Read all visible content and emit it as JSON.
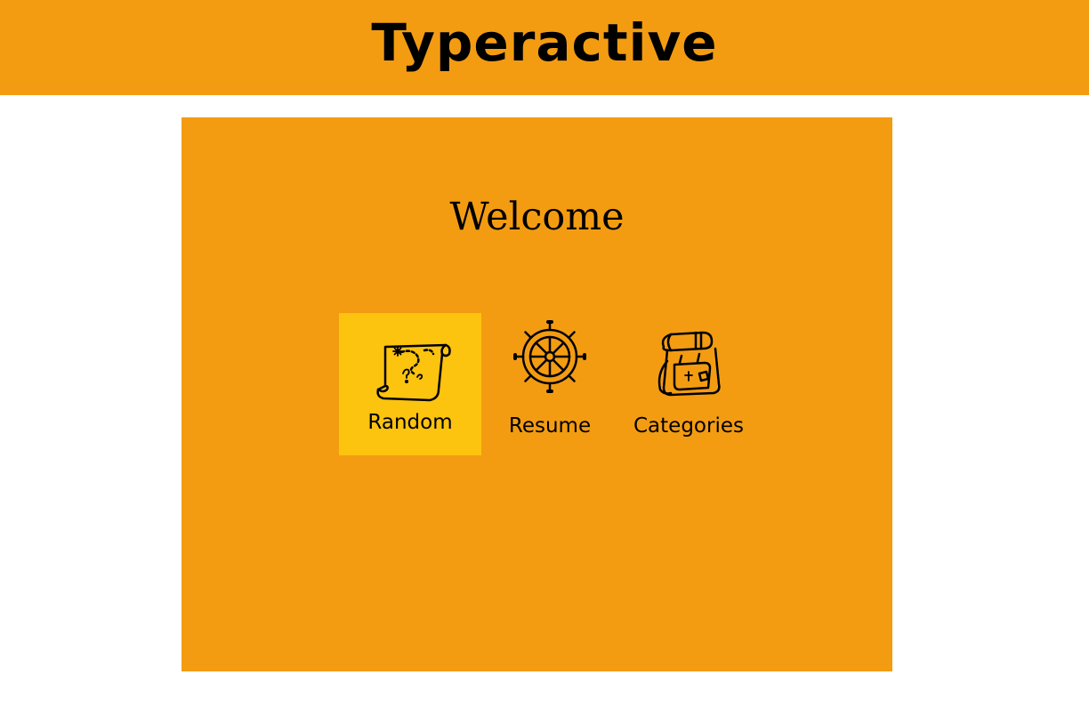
{
  "header": {
    "title": "Typeractive"
  },
  "main": {
    "welcome": "Welcome",
    "menu": [
      {
        "label": "Random",
        "icon": "treasure-map-icon",
        "selected": true
      },
      {
        "label": "Resume",
        "icon": "ship-wheel-icon",
        "selected": false
      },
      {
        "label": "Categories",
        "icon": "backpack-icon",
        "selected": false
      }
    ]
  },
  "colors": {
    "header_bg": "#f39c12",
    "panel_bg": "#f39c12",
    "selected_tile_bg": "#fcc30f",
    "page_bg": "#ffffff"
  }
}
